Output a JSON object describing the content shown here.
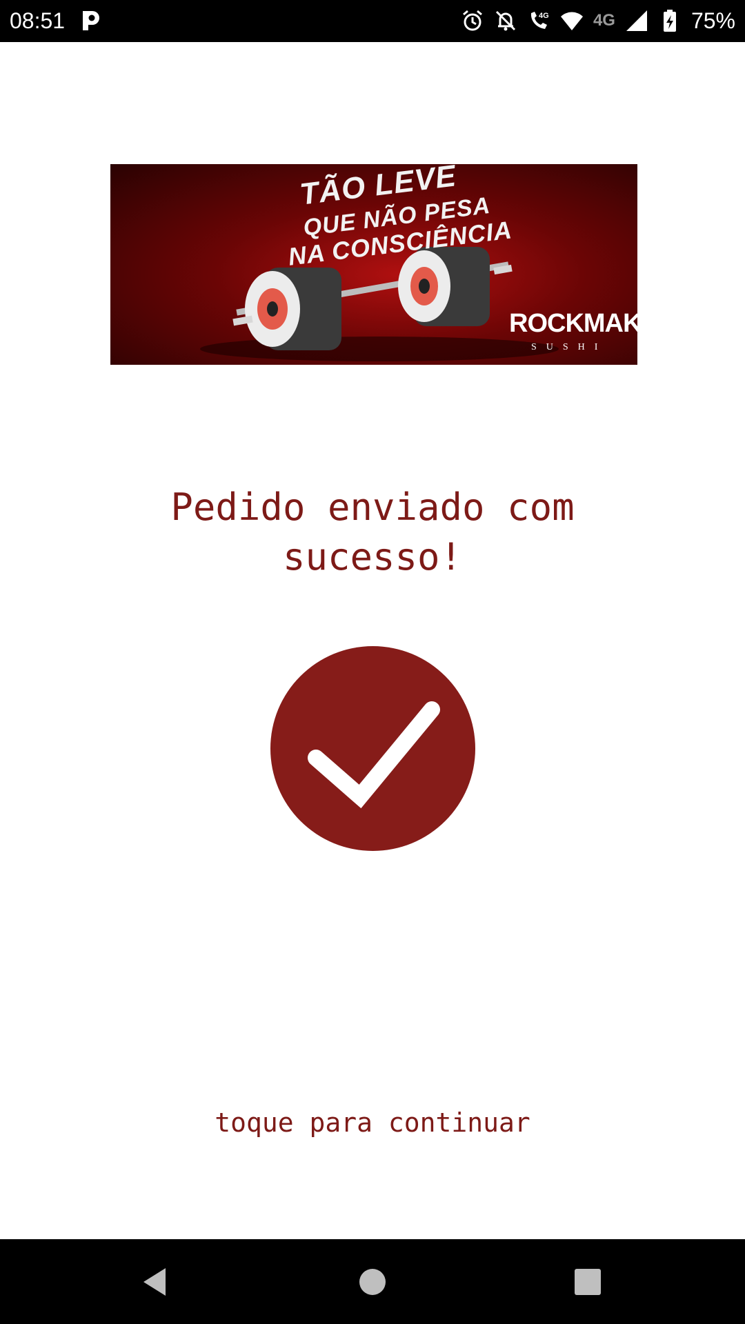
{
  "status_bar": {
    "time": "08:51",
    "app_icon": "p-letter-icon",
    "four_g_label": "4G",
    "battery_percent": "75%",
    "icons": [
      "alarm-icon",
      "notifications-off-icon",
      "wifi-calling-4g-icon",
      "wifi-icon",
      "signal-icon",
      "battery-charging-icon"
    ]
  },
  "banner": {
    "line_1": "TÃO LEVE",
    "line_2": "QUE NÃO PESA",
    "line_3": "NA CONSCIÊNCIA",
    "logo": "ROCKMAKI",
    "logo_sub": "SUSHI"
  },
  "main": {
    "title": "Pedido enviado com sucesso!",
    "continue_hint": "toque para continuar"
  },
  "colors": {
    "accent": "#7d1a17",
    "check_circle": "#861c19",
    "background": "#ffffff",
    "system_bars": "#000000"
  },
  "nav_bar": {
    "icons": [
      "back-icon",
      "home-icon",
      "recents-icon"
    ]
  }
}
